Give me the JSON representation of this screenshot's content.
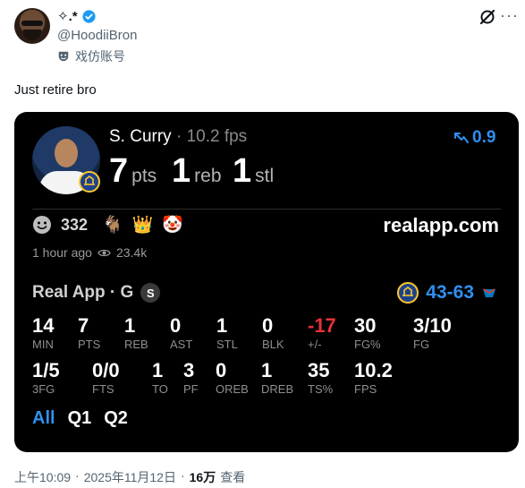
{
  "author": {
    "display_name": "✧.*",
    "handle": "@HoodiiBron",
    "parody_label": "戏仿账号"
  },
  "tweet": {
    "text": "Just retire bro"
  },
  "card": {
    "player": "S. Curry",
    "fps": "10.2 fps",
    "headline_stats": [
      {
        "num": "7",
        "unit": "pts"
      },
      {
        "num": "1",
        "unit": "reb"
      },
      {
        "num": "1",
        "unit": "stl"
      }
    ],
    "rating": "0.9",
    "reaction_count": "332",
    "reaction_emojis": [
      "🐐",
      "👑",
      "🤡"
    ],
    "site": "realapp.com",
    "time_ago": "1 hour ago",
    "views": "23.4k",
    "game_label": "Real App · G",
    "badge": "S",
    "score_team": "43",
    "score_sep": "-",
    "score_opp": "63",
    "stats_row1": [
      {
        "v": "14",
        "l": "MIN"
      },
      {
        "v": "7",
        "l": "PTS"
      },
      {
        "v": "1",
        "l": "REB"
      },
      {
        "v": "0",
        "l": "AST"
      },
      {
        "v": "1",
        "l": "STL"
      },
      {
        "v": "0",
        "l": "BLK"
      },
      {
        "v": "-17",
        "l": "+/-"
      },
      {
        "v": "30",
        "l": "FG%"
      },
      {
        "v": "3/10",
        "l": "FG"
      }
    ],
    "stats_row2": [
      {
        "v": "1/5",
        "l": "3FG"
      },
      {
        "v": "0/0",
        "l": "FTS"
      },
      {
        "v": "1",
        "l": "TO"
      },
      {
        "v": "3",
        "l": "PF"
      },
      {
        "v": "0",
        "l": "OREB"
      },
      {
        "v": "1",
        "l": "DREB"
      },
      {
        "v": "35",
        "l": "TS%"
      },
      {
        "v": "10.2",
        "l": "FPS"
      }
    ],
    "tabs": [
      "All",
      "Q1",
      "Q2"
    ]
  },
  "footer": {
    "time": "上午10:09",
    "date": "2025年11月12日",
    "views_num": "16万",
    "views_label": "查看"
  },
  "colors": {
    "accent_blue": "#2f8ff0",
    "negative_red": "#e8303a",
    "card_bg": "#000000"
  }
}
